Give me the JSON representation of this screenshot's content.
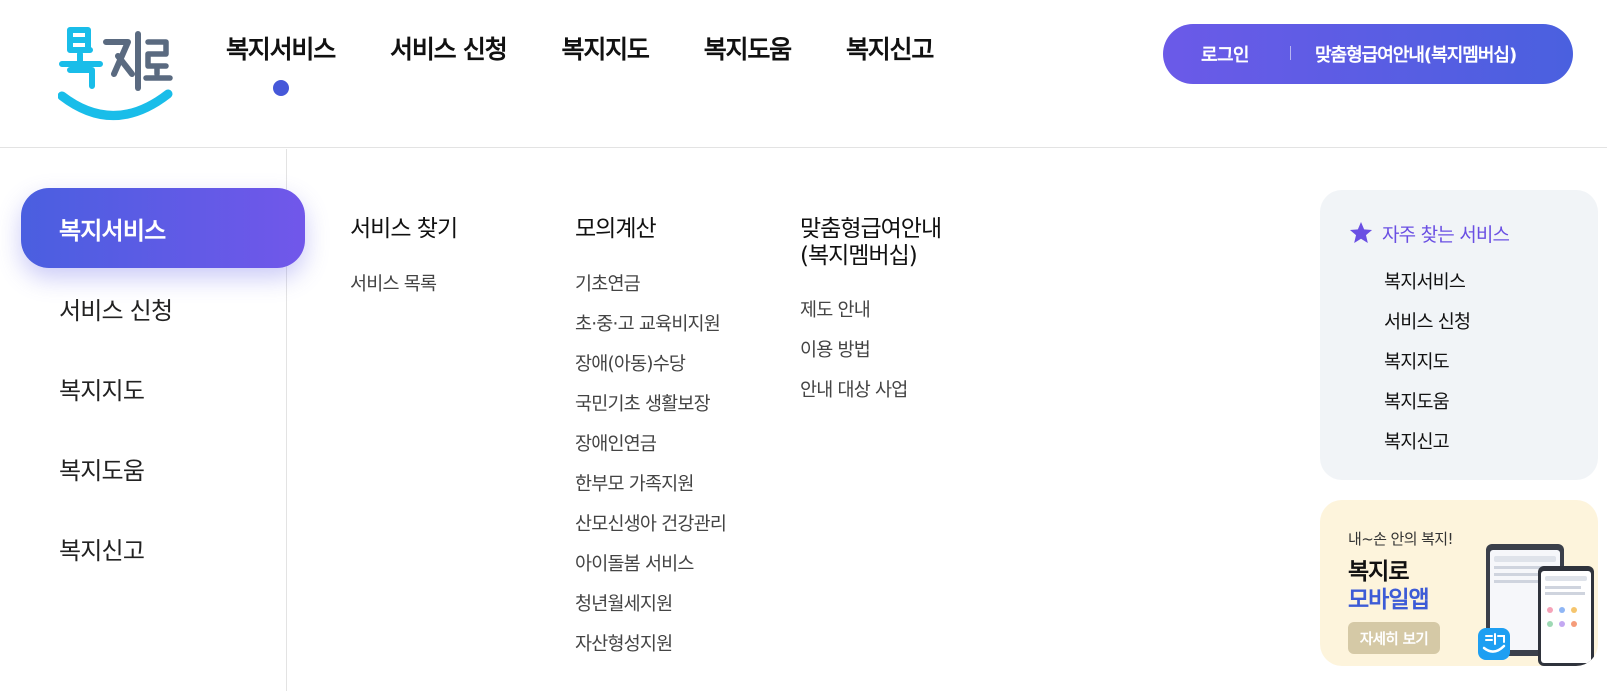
{
  "header": {
    "logo_alt": "복지로",
    "gnb": [
      "복지서비스",
      "서비스 신청",
      "복지지도",
      "복지도움",
      "복지신고"
    ],
    "active_gnb_index": 0,
    "login_label": "로그인",
    "membership_label": "맞춤형급여안내(복지멤버십)"
  },
  "lnb": {
    "items": [
      "복지서비스",
      "서비스 신청",
      "복지지도",
      "복지도움",
      "복지신고"
    ],
    "active_index": 0
  },
  "columns": [
    {
      "title": "서비스 찾기",
      "links": [
        "서비스 목록"
      ]
    },
    {
      "title": "모의계산",
      "links": [
        "기초연금",
        "초·중·고 교육비지원",
        "장애(아동)수당",
        "국민기초 생활보장",
        "장애인연금",
        "한부모 가족지원",
        "산모신생아 건강관리",
        "아이돌봄 서비스",
        "청년월세지원",
        "자산형성지원"
      ]
    },
    {
      "title_lines": [
        "맞춤형급여안내",
        "(복지멤버십)"
      ],
      "links": [
        "제도 안내",
        "이용 방법",
        "안내 대상 사업"
      ]
    }
  ],
  "frequent": {
    "title": "자주 찾는 서비스",
    "links": [
      "복지서비스",
      "서비스 신청",
      "복지지도",
      "복지도움",
      "복지신고"
    ]
  },
  "app_banner": {
    "subtitle": "내~손 안의 복지!",
    "title_line1": "복지로",
    "title_line2": "모바일앱",
    "button_label": "자세히 보기"
  },
  "colors": {
    "brand_blue": "#4a60df",
    "brand_purple": "#6b5ae8",
    "logo_cyan": "#19bde9",
    "freq_bg": "#f1f4f7",
    "app_bg": "#fdf4dc"
  }
}
